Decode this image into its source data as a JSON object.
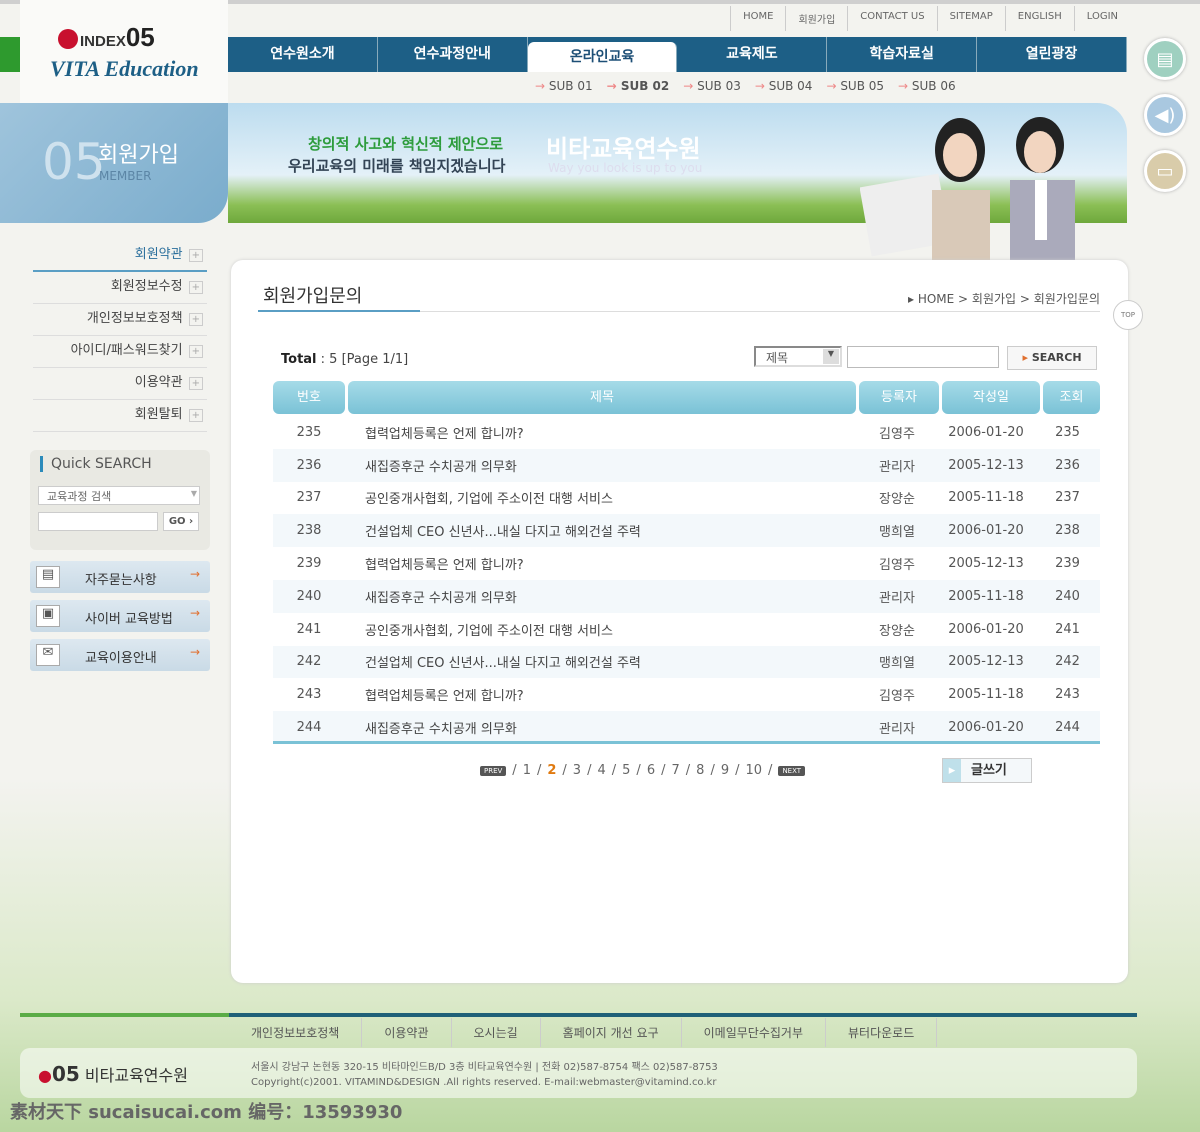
{
  "logo": {
    "index": "INDEX",
    "num": "05",
    "brand": "VITA Education"
  },
  "util_links": [
    "HOME",
    "회원가입",
    "CONTACT US",
    "SITEMAP",
    "ENGLISH",
    "LOGIN"
  ],
  "nav": [
    {
      "label": "연수원소개"
    },
    {
      "label": "연수과정안내"
    },
    {
      "label": "온라인교육",
      "active": true
    },
    {
      "label": "교육제도"
    },
    {
      "label": "학습자료실"
    },
    {
      "label": "열린광장"
    }
  ],
  "subnav": [
    {
      "label": "SUB 01"
    },
    {
      "label": "SUB 02",
      "active": true
    },
    {
      "label": "SUB 03"
    },
    {
      "label": "SUB 04"
    },
    {
      "label": "SUB 05"
    },
    {
      "label": "SUB 06"
    }
  ],
  "section": {
    "num": "05",
    "title": "회원가입",
    "en": "MEMBER"
  },
  "banner": {
    "slogan1": "창의적 사고와 혁신적 제안으로",
    "slogan2": "우리교육의 미래를 책임지겠습니다",
    "name": "비타교육연수원",
    "tagline": "Way you look is up to you"
  },
  "side_menu": [
    {
      "label": "회원약관",
      "active": true
    },
    {
      "label": "회원정보수정"
    },
    {
      "label": "개인정보보호정책"
    },
    {
      "label": "아이디/패스워드찾기"
    },
    {
      "label": "이용약관"
    },
    {
      "label": "회원탈퇴"
    }
  ],
  "quick_search": {
    "title": "Quick SEARCH",
    "select": "교육과정 검색",
    "go": "GO"
  },
  "quick_links": [
    {
      "label": "자주묻는사항",
      "icon": "document-icon"
    },
    {
      "label": "사이버 교육방법",
      "icon": "computer-icon"
    },
    {
      "label": "교육이용안내",
      "icon": "mail-icon"
    }
  ],
  "page": {
    "title": "회원가입문의",
    "breadcrumb": "HOME > 회원가입 > 회원가입문의",
    "top": "TOP"
  },
  "search": {
    "total_label": "Total",
    "total": ": 5 [Page 1/1]",
    "field": "제목",
    "button": "SEARCH"
  },
  "table": {
    "headers": [
      "번호",
      "제목",
      "등록자",
      "작성일",
      "조회"
    ],
    "rows": [
      [
        "235",
        "협력업체등록은 언제 합니까?",
        "김영주",
        "2006-01-20",
        "235"
      ],
      [
        "236",
        "새집증후군 수치공개 의무화",
        "관리자",
        "2005-12-13",
        "236"
      ],
      [
        "237",
        "공인중개사협회, 기업에 주소이전 대행 서비스",
        "장양순",
        "2005-11-18",
        "237"
      ],
      [
        "238",
        "건설업체 CEO 신년사...내실 다지고 해외건설 주력",
        "맹희열",
        "2006-01-20",
        "238"
      ],
      [
        "239",
        "협력업체등록은 언제 합니까?",
        "김영주",
        "2005-12-13",
        "239"
      ],
      [
        "240",
        "새집증후군 수치공개 의무화",
        "관리자",
        "2005-11-18",
        "240"
      ],
      [
        "241",
        "공인중개사협회, 기업에 주소이전 대행 서비스",
        "장양순",
        "2006-01-20",
        "241"
      ],
      [
        "242",
        "건설업체 CEO 신년사...내실 다지고 해외건설 주력",
        "맹희열",
        "2005-12-13",
        "242"
      ],
      [
        "243",
        "협력업체등록은 언제 합니까?",
        "김영주",
        "2005-11-18",
        "243"
      ],
      [
        "244",
        "새집증후군 수치공개 의무화",
        "관리자",
        "2006-01-20",
        "244"
      ]
    ]
  },
  "pager": {
    "prev": "PREV",
    "next": "NEXT",
    "pages": [
      "1",
      "2",
      "3",
      "4",
      "5",
      "6",
      "7",
      "8",
      "9",
      "10"
    ],
    "current": "2"
  },
  "write_button": "글쓰기",
  "footer": {
    "links": [
      "개인정보보호정책",
      "이용약관",
      "오시는길",
      "홈페이지 개선 요구",
      "이메일무단수집거부",
      "뷰터다운로드"
    ],
    "name": "비타교육연수원",
    "address": "서울시 강남구 논현동 320-15 비타마인드B/D 3층 비타교육연수원 | 전화 02)587-8754 팩스 02)587-8753",
    "copyright": "Copyright(c)2001. VITAMIND&DESIGN .All rights reserved. E-mail:webmaster@vitamind.co.kr"
  },
  "watermark": "素材天下 sucaisucai.com  编号：13593930",
  "colors": {
    "nav": "#1d5f86",
    "table_header": "#7ac2d6",
    "accent_green": "#5aac46"
  }
}
